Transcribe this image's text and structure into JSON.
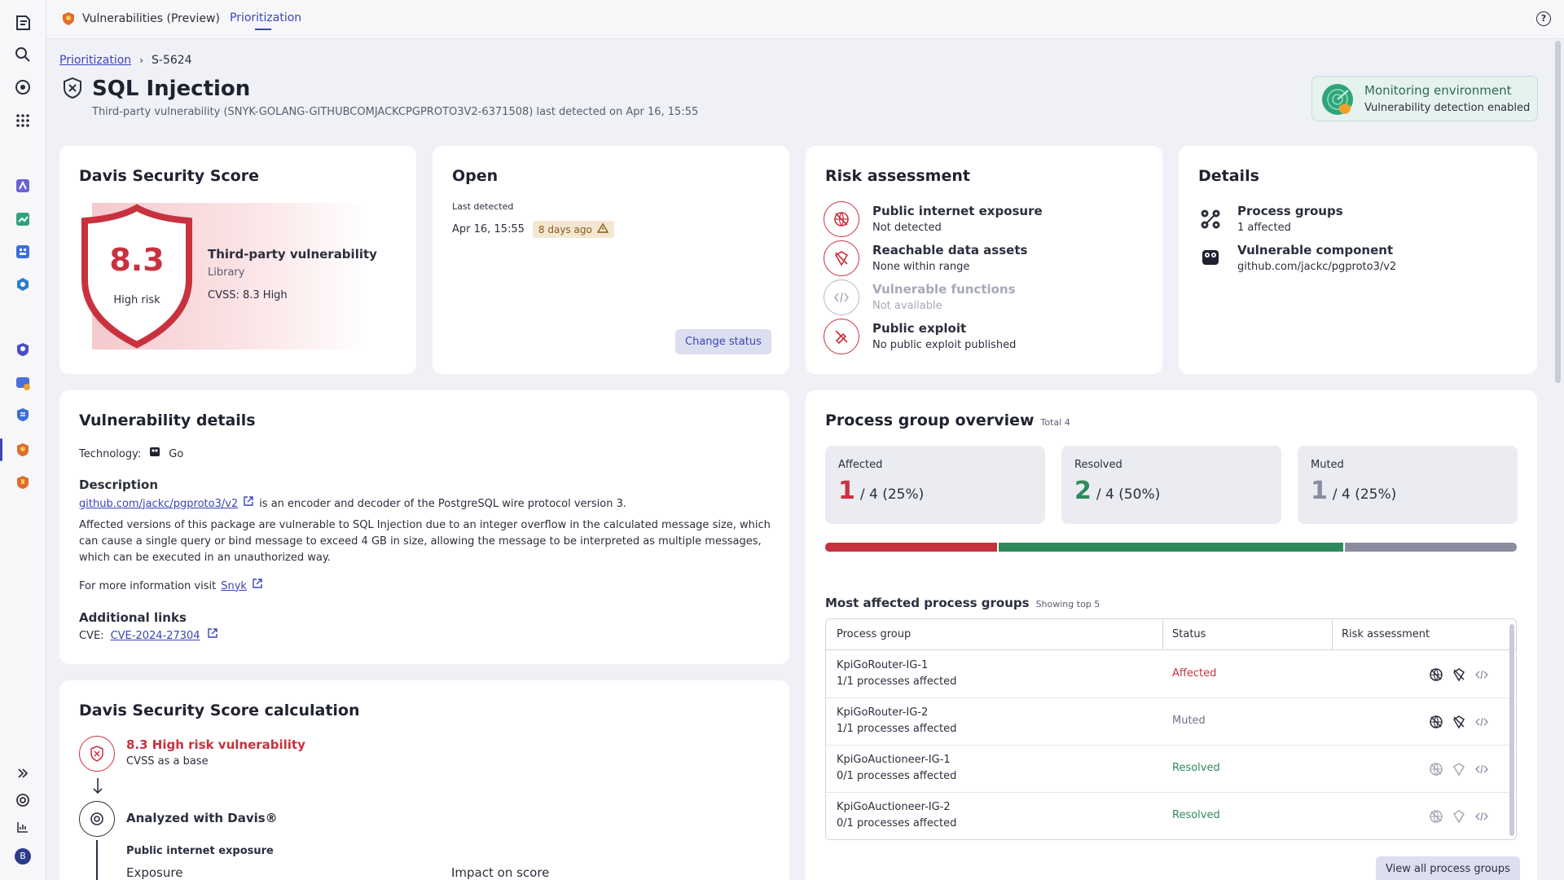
{
  "topbar": {
    "app_title": "Vulnerabilities (Preview)",
    "tab": "Prioritization",
    "help_label": "?"
  },
  "rail": {
    "avatar_initial": "B"
  },
  "breadcrumb": {
    "parent": "Prioritization",
    "current": "S-5624"
  },
  "header": {
    "title": "SQL Injection",
    "subtitle": "Third-party vulnerability (SNYK-GOLANG-GITHUBCOMJACKCPGPROTO3V2-6371508) last detected on Apr 16, 15:55"
  },
  "environment": {
    "title": "Monitoring environment",
    "subtitle": "Vulnerability detection enabled"
  },
  "score_card": {
    "title": "Davis Security Score",
    "score": "8.3",
    "risk": "High risk",
    "type": "Third-party vulnerability",
    "category": "Library",
    "cvss": "CVSS: 8.3 High"
  },
  "open_card": {
    "title": "Open",
    "last_detected_label": "Last detected",
    "last_detected_value": "Apr 16, 15:55",
    "badge": "8 days ago",
    "change_status": "Change status"
  },
  "risk_card": {
    "title": "Risk assessment",
    "items": [
      {
        "title": "Public internet exposure",
        "value": "Not detected"
      },
      {
        "title": "Reachable data assets",
        "value": "None within range"
      },
      {
        "title": "Vulnerable functions",
        "value": "Not available"
      },
      {
        "title": "Public exploit",
        "value": "No public exploit published"
      }
    ]
  },
  "details_card": {
    "title": "Details",
    "process_groups_label": "Process groups",
    "process_groups_value": "1 affected",
    "component_label": "Vulnerable component",
    "component_value": "github.com/jackc/pgproto3/v2"
  },
  "vuln_details": {
    "title": "Vulnerability details",
    "technology_label": "Technology:",
    "technology_value": "Go",
    "description_label": "Description",
    "description_link": "github.com/jackc/pgproto3/v2",
    "description_rest": "is an encoder and decoder of the PostgreSQL wire protocol version 3.",
    "description_body": "Affected versions of this package are vulnerable to SQL Injection due to an integer overflow in the calculated message size, which can cause a single query or bind message to exceed 4 GB in size, allowing the message to be interpreted as multiple messages, which can be executed in an unauthorized way.",
    "more_info_prefix": "For more information visit",
    "more_info_link": "Snyk",
    "additional_links_label": "Additional links",
    "cve_label": "CVE:",
    "cve_link": "CVE-2024-27304"
  },
  "calc_card": {
    "title": "Davis Security Score calculation",
    "step1_title": "8.3 High risk vulnerability",
    "step1_sub": "CVSS as a base",
    "step2_title": "Analyzed with Davis®",
    "sub_title": "Public internet exposure",
    "exposure_label": "Exposure",
    "impact_label": "Impact on score"
  },
  "pg_overview": {
    "title": "Process group overview",
    "total": "Total 4",
    "affected_label": "Affected",
    "affected_value": "1",
    "affected_rest": "/ 4 (25%)",
    "resolved_label": "Resolved",
    "resolved_value": "2",
    "resolved_rest": "/ 4 (50%)",
    "muted_label": "Muted",
    "muted_value": "1",
    "muted_rest": "/ 4 (25%)",
    "bar": {
      "affected": 0.25,
      "resolved": 0.5,
      "muted": 0.25
    },
    "most_affected_title": "Most affected process groups",
    "showing": "Showing top 5",
    "columns": [
      "Process group",
      "Status",
      "Risk assessment"
    ],
    "rows": [
      {
        "name": "KpiGoRouter-IG-1",
        "processes": "1/1 processes affected",
        "status": "Affected"
      },
      {
        "name": "KpiGoRouter-IG-2",
        "processes": "1/1 processes affected",
        "status": "Muted"
      },
      {
        "name": "KpiGoAuctioneer-IG-1",
        "processes": "0/1 processes affected",
        "status": "Resolved"
      },
      {
        "name": "KpiGoAuctioneer-IG-2",
        "processes": "0/1 processes affected",
        "status": "Resolved"
      }
    ],
    "view_all": "View all process groups"
  },
  "colors": {
    "accent": "#3a44b8",
    "affected": "#c8323f",
    "resolved": "#2f8a5b",
    "muted": "#8a8ca0"
  }
}
